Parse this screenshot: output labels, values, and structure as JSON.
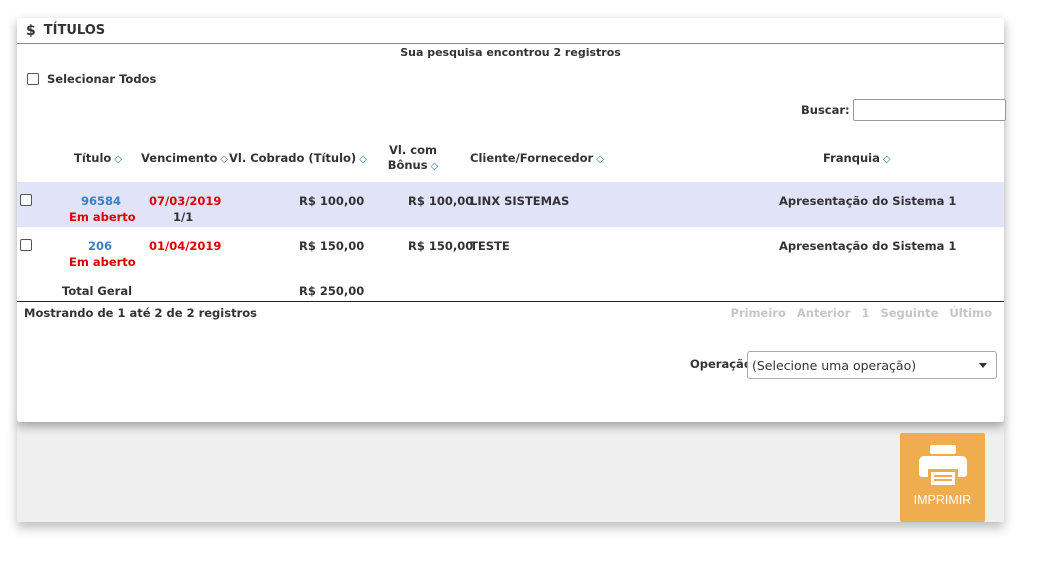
{
  "panel": {
    "title_icon": "$",
    "title": "TÍTULOS",
    "summary": "Sua pesquisa encontrou 2 registros",
    "select_all_label": "Selecionar Todos",
    "search_label": "Buscar:",
    "search_value": ""
  },
  "table": {
    "headers": {
      "titulo": "Título",
      "vencimento": "Vencimento",
      "vl_cobrado": "Vl. Cobrado (Título)",
      "vl_bonus_line1": "Vl. com",
      "vl_bonus_line2": "Bônus",
      "cliente": "Cliente/Fornecedor",
      "franquia": "Franquia"
    },
    "sort_icon": "◇",
    "rows": [
      {
        "titulo": "96584",
        "status": "Em aberto",
        "vencimento": "07/03/2019",
        "parcela": "1/1",
        "vl_cobrado": "R$ 100,00",
        "vl_bonus": "R$ 100,00",
        "cliente": "LINX SISTEMAS",
        "franquia": "Apresentação do Sistema 1"
      },
      {
        "titulo": "206",
        "status": "Em aberto",
        "vencimento": "01/04/2019",
        "parcela": "",
        "vl_cobrado": "R$ 150,00",
        "vl_bonus": "R$ 150,00",
        "cliente": "TESTE",
        "franquia": "Apresentação do Sistema 1"
      }
    ],
    "total_label": "Total Geral",
    "total_value": "R$ 250,00"
  },
  "pagination": {
    "info": "Mostrando de 1 até 2 de 2 registros",
    "first": "Primeiro",
    "previous": "Anterior",
    "page": "1",
    "next": "Seguinte",
    "last": "Último"
  },
  "operation": {
    "label": "Operação",
    "selected": "(Selecione uma operação)"
  },
  "print_button": {
    "label": "IMPRIMIR",
    "icon": "printer-icon",
    "color": "#f0ad4e"
  },
  "colors": {
    "highlight_row": "#e1e3f8",
    "link": "#3b7fc0",
    "due_date": "#dd0000"
  }
}
